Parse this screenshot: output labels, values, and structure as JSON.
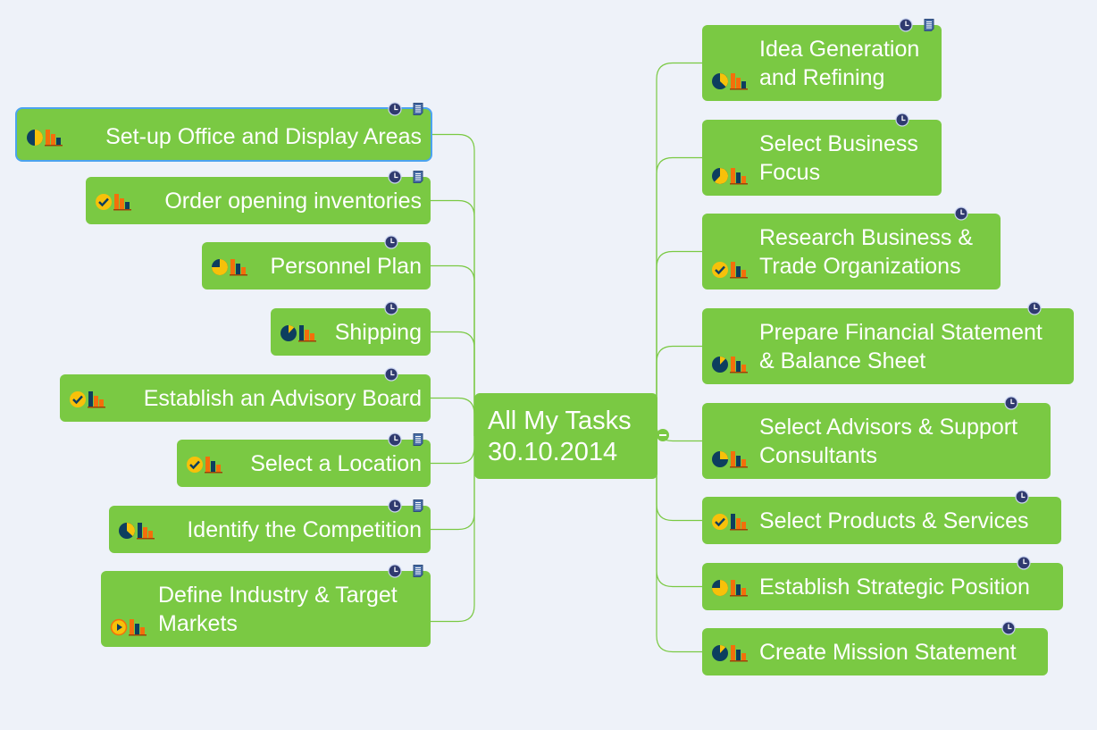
{
  "map": {
    "central_topic": {
      "line1": "All My Tasks",
      "line2": "30.10.2014"
    },
    "colors": {
      "background": "#eef2f9",
      "node": "#7ac943",
      "connector": "#7ac943",
      "selection": "#4ba3ef",
      "icon_dark": "#0d3e5f",
      "icon_yellow": "#f7c10a",
      "icon_orange": "#f36f0b",
      "marker": "#2f3a6f"
    },
    "left_topics": [
      {
        "label": "Set-up Office and Display Areas",
        "progress": "50%",
        "priority": "high",
        "markers": [
          "clock-icon",
          "note-icon"
        ],
        "selected": true
      },
      {
        "label": "Order opening inventories",
        "progress": "done",
        "priority": "high",
        "markers": [
          "clock-icon",
          "note-icon"
        ]
      },
      {
        "label": "Personnel Plan",
        "progress": "75%",
        "priority": "medium",
        "markers": [
          "clock-icon"
        ]
      },
      {
        "label": "Shipping",
        "progress": "12%",
        "priority": "low",
        "markers": [
          "clock-icon"
        ]
      },
      {
        "label": "Establish an Advisory Board",
        "progress": "done",
        "priority": "low",
        "markers": [
          "clock-icon"
        ]
      },
      {
        "label": "Select a Location",
        "progress": "done",
        "priority": "medium",
        "markers": [
          "clock-icon",
          "note-icon"
        ]
      },
      {
        "label": "Identify the Competition",
        "progress": "37%",
        "priority": "low",
        "markers": [
          "clock-icon",
          "note-icon"
        ]
      },
      {
        "label": "Define Industry & Target\nMarkets",
        "progress": "started",
        "priority": "medium",
        "markers": [
          "clock-icon",
          "note-icon"
        ]
      }
    ],
    "right_topics": [
      {
        "label": "Idea Generation\nand Refining",
        "progress": "37%",
        "priority": "high",
        "markers": [
          "clock-icon",
          "note-icon"
        ]
      },
      {
        "label": "Select Business\nFocus",
        "progress": "62%",
        "priority": "medium",
        "markers": [
          "clock-icon"
        ]
      },
      {
        "label": "Research Business &\nTrade Organizations",
        "progress": "done",
        "priority": "medium",
        "markers": [
          "clock-icon"
        ]
      },
      {
        "label": "Prepare Financial Statement\n& Balance Sheet",
        "progress": "12%",
        "priority": "medium",
        "markers": [
          "clock-icon"
        ]
      },
      {
        "label": "Select Advisors & Support\nConsultants",
        "progress": "25%",
        "priority": "medium",
        "markers": [
          "clock-icon"
        ]
      },
      {
        "label": "Select Products & Services",
        "progress": "done",
        "priority": "low",
        "markers": [
          "clock-icon"
        ]
      },
      {
        "label": "Establish Strategic Position",
        "progress": "75%",
        "priority": "medium",
        "markers": [
          "clock-icon"
        ]
      },
      {
        "label": "Create Mission Statement",
        "progress": "12%",
        "priority": "medium",
        "markers": [
          "clock-icon"
        ]
      }
    ]
  }
}
